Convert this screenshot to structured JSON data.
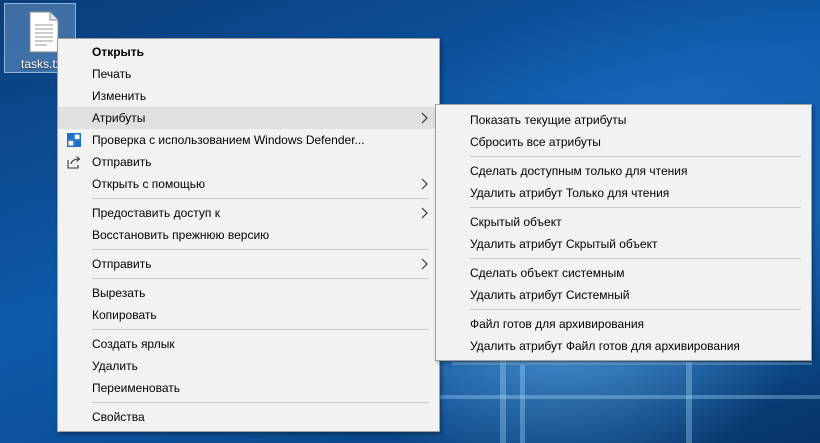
{
  "desktop": {
    "file_icon_label": "tasks.txt",
    "file_icon_name": "text-file-icon"
  },
  "context_menu": {
    "items": [
      {
        "label": "Открыть",
        "bold": true
      },
      {
        "label": "Печать"
      },
      {
        "label": "Изменить"
      },
      {
        "label": "Атрибуты",
        "submenu": true,
        "highlighted": true
      },
      {
        "label": "Проверка с использованием Windows Defender...",
        "icon": "windows-defender-icon"
      },
      {
        "label": "Отправить",
        "icon": "share-icon"
      },
      {
        "label": "Открыть с помощью",
        "submenu": true
      },
      {
        "label": "Предоставить доступ к",
        "submenu": true
      },
      {
        "label": "Восстановить прежнюю версию"
      },
      {
        "label": "Отправить",
        "submenu": true
      },
      {
        "label": "Вырезать"
      },
      {
        "label": "Копировать"
      },
      {
        "label": "Создать ярлык"
      },
      {
        "label": "Удалить"
      },
      {
        "label": "Переименовать"
      },
      {
        "label": "Свойства"
      }
    ]
  },
  "attributes_submenu": {
    "items": [
      {
        "label": "Показать текущие атрибуты"
      },
      {
        "label": "Сбросить все атрибуты"
      },
      {
        "label": "Сделать доступным только для чтения"
      },
      {
        "label": "Удалить атрибут Только для чтения"
      },
      {
        "label": "Скрытый объект"
      },
      {
        "label": "Удалить атрибут Скрытый объект"
      },
      {
        "label": "Сделать объект системным"
      },
      {
        "label": "Удалить атрибут Системный"
      },
      {
        "label": "Файл готов для архивирования"
      },
      {
        "label": "Удалить атрибут Файл готов для архивирования"
      }
    ]
  },
  "colors": {
    "menu_background": "#f2f2f2",
    "menu_highlight": "#e0e0e0",
    "separator": "#c8c8c8",
    "defender_blue": "#1f6fc5"
  }
}
